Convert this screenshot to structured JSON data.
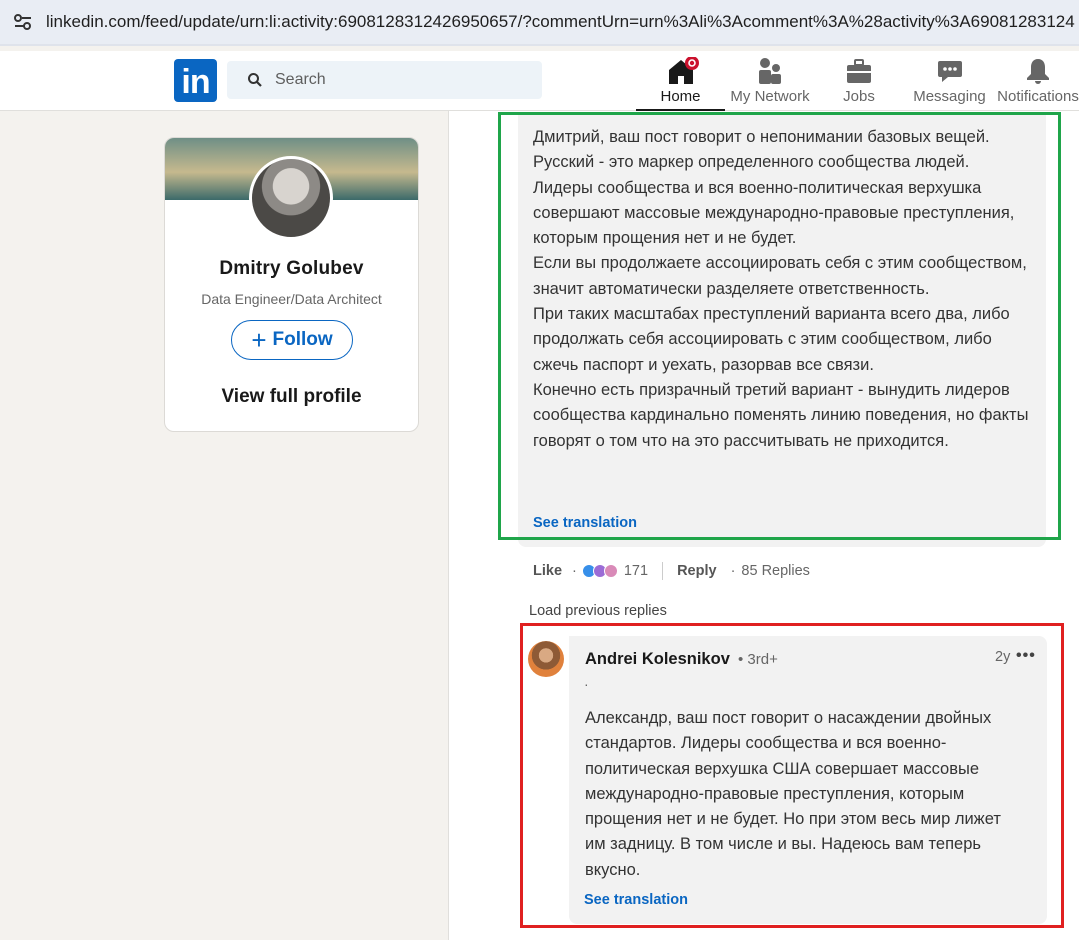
{
  "browser": {
    "url": "linkedin.com/feed/update/urn:li:activity:6908128312426950657/?commentUrn=urn%3Ali%3Acomment%3A%28activity%3A69081283124"
  },
  "nav": {
    "logo": "in",
    "search_placeholder": "Search",
    "items": [
      {
        "label": "Home",
        "icon": "home-icon",
        "active": true
      },
      {
        "label": "My Network",
        "icon": "network-icon"
      },
      {
        "label": "Jobs",
        "icon": "briefcase-icon"
      },
      {
        "label": "Messaging",
        "icon": "chat-icon"
      },
      {
        "label": "Notifications",
        "icon": "bell-icon"
      }
    ]
  },
  "profile": {
    "name": "Dmitry Golubev",
    "title": "Data Engineer/Data Architect",
    "follow_label": "Follow",
    "view_profile_label": "View full profile"
  },
  "comment1": {
    "text": "Дмитрий, ваш пост говорит о непонимании базовых вещей.\nРусский - это маркер определенного сообщества людей.\nЛидеры сообщества и вся военно-политическая верхушка совершают массовые международно-правовые преступления, которым прощения нет и не будет.\nЕсли вы продолжаете ассоциировать себя с этим сообществом, значит автоматически разделяете ответственность.\nПри таких масштабах преступлений варианта всего два, либо продолжать себя ассоциировать с этим сообществом, либо сжечь паспорт и уехать, разорвав все связи.\nКонечно есть призрачный третий вариант - вынудить лидеров сообщества кардинально поменять линию поведения, но факты говорят о том что на это рассчитывать не приходится.",
    "see_translation": "See translation",
    "like_label": "Like",
    "reactions_count": "171",
    "reply_label": "Reply",
    "replies_count": "85 Replies"
  },
  "load_previous": "Load previous replies",
  "reply": {
    "author": "Andrei Kolesnikov",
    "degree": "• 3rd+",
    "time": "2y",
    "more": "•••",
    "dot": "·",
    "text": "Александр, ваш пост говорит о насаждении двойных стандартов. Лидеры сообщества и вся военно-политическая верхушка США совершает массовые международно-правовые преступления, которым прощения нет и не будет. Но при этом весь мир лижет им задницу. В том числе и вы. Надеюсь вам теперь вкусно.",
    "see_translation": "See translation"
  },
  "colors": {
    "linkedin_blue": "#0a66c2",
    "highlight_green": "#1fa54a",
    "highlight_red": "#e02020",
    "notification_red": "#cb112d"
  }
}
